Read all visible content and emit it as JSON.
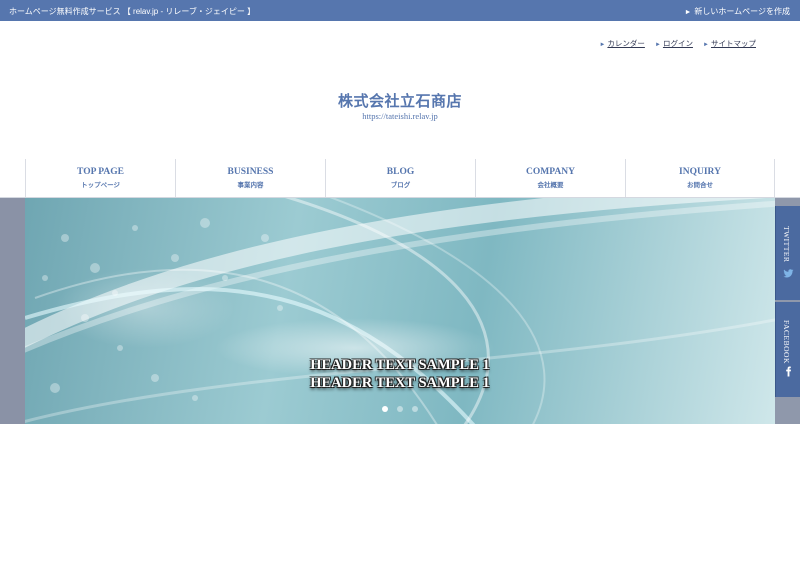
{
  "topbar": {
    "service_text": "ホームページ無料作成サービス 【 relav.jp - リレーブ・ジェイピー 】",
    "create_link_arrow": "►",
    "create_link": "新しいホームページを作成"
  },
  "util_links": {
    "calendar": "カレンダー",
    "login": "ログイン",
    "sitemap": "サイトマップ",
    "marker": "►"
  },
  "site": {
    "title": "株式会社立石商店",
    "url": "https://tateishi.relav.jp"
  },
  "nav": {
    "items": [
      {
        "en": "TOP PAGE",
        "jp": "トップページ"
      },
      {
        "en": "BUSINESS",
        "jp": "事業内容"
      },
      {
        "en": "BLOG",
        "jp": "ブログ"
      },
      {
        "en": "COMPANY",
        "jp": "会社概要"
      },
      {
        "en": "INQUIRY",
        "jp": "お問合せ"
      }
    ]
  },
  "hero": {
    "line1": "HEADER TEXT SAMPLE 1",
    "line2": "HEADER TEXT SAMPLE 1",
    "slide_count": 3,
    "active_slide": 1
  },
  "social": {
    "twitter": "TWITTER",
    "facebook": "FACEBOOK",
    "color": "#4b6aa0"
  },
  "colors": {
    "brand": "#5676ae"
  },
  "icons": {
    "twitter": "bird-icon",
    "facebook": "facebook-f-icon",
    "link_arrow": "triangle-right-icon"
  }
}
